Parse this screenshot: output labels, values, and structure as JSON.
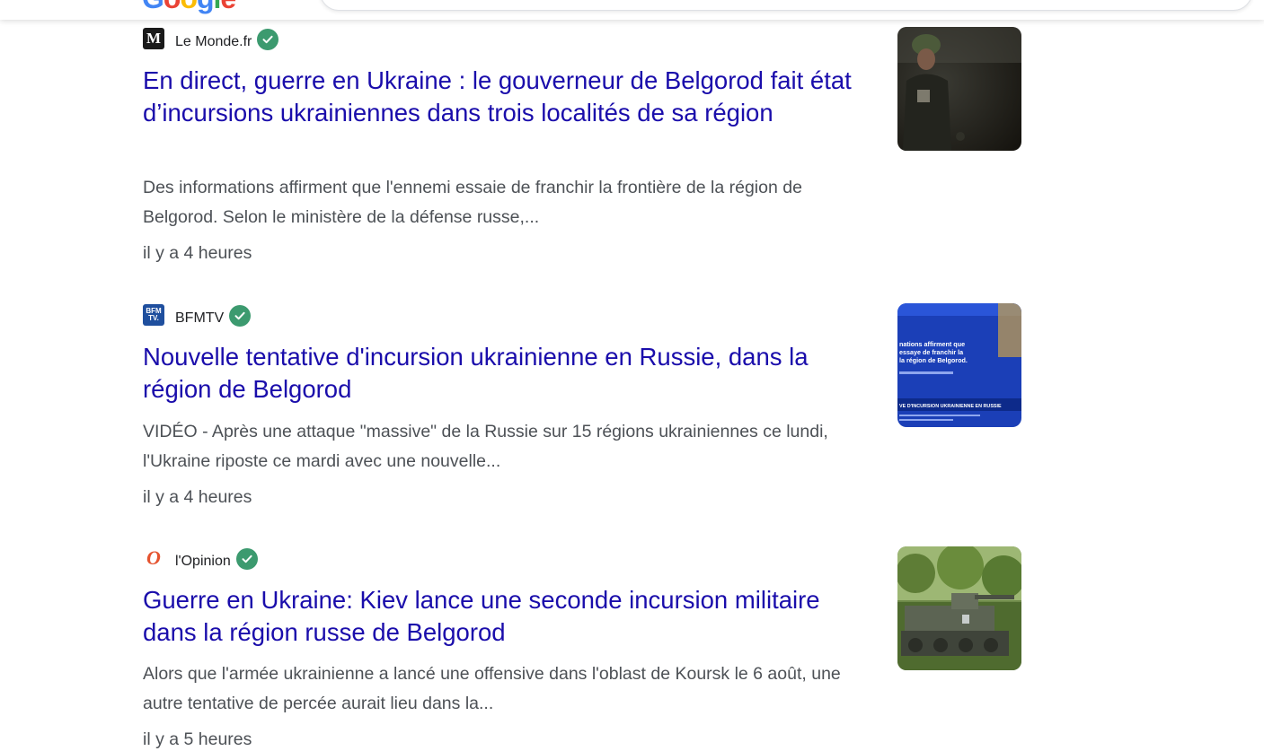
{
  "header": {
    "logo_letters": [
      "G",
      "o",
      "o",
      "g",
      "l",
      "e"
    ],
    "logo_colors": [
      "#4285F4",
      "#EA4335",
      "#FBBC05",
      "#4285F4",
      "#34A853",
      "#EA4335"
    ]
  },
  "results": [
    {
      "source": "Le Monde.fr",
      "favicon_text": "M",
      "title": "En direct, guerre en Ukraine : le gouverneur de Belgorod fait état d’incursions ukrainiennes dans trois localités de sa région",
      "snippet": "Des informations affirment que l'ennemi essaie de franchir la frontière de la région de Belgorod. Selon le ministère de la défense russe,...",
      "time": "il y a 4 heures"
    },
    {
      "source": "BFMTV",
      "favicon_text": "BFM TV.",
      "title": "Nouvelle tentative d'incursion ukrainienne en Russie, dans la région de Belgorod",
      "snippet": "VIDÉO - Après une attaque \"massive\" de la Russie sur 15 régions ukrainiennes ce lundi, l'Ukraine riposte ce mardi avec une nouvelle...",
      "time": "il y a 4 heures",
      "thumbnail_text": [
        "nations affirment que",
        "essaye de franchir la",
        "la région de Belgorod.",
        "VE D'INCURSION UKRAINIENNE EN RUSSIE"
      ]
    },
    {
      "source": "l'Opinion",
      "favicon_text": "O",
      "title": "Guerre en Ukraine: Kiev lance une seconde incursion militaire dans la région russe de Belgorod",
      "snippet": "Alors que l'armée ukrainienne a lancé une offensive dans l'oblast de Koursk le 6 août, une autre tentative de percée aurait lieu dans la...",
      "time": "il y a 5 heures"
    }
  ],
  "colors": {
    "title_link": "#1a0dab",
    "snippet_text": "#4d5156",
    "verified_badge": "#3c9a6f"
  }
}
